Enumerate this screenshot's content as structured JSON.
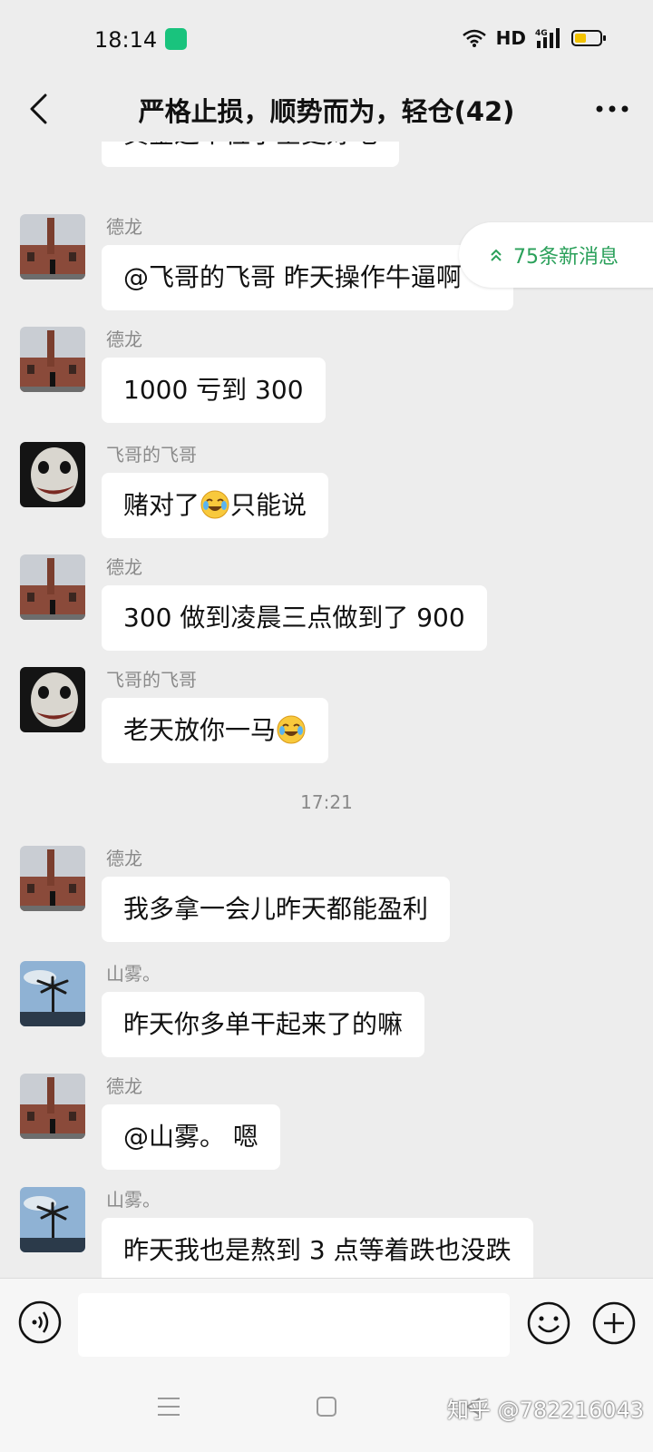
{
  "status_bar": {
    "time": "18:14",
    "network": "HD",
    "cell": "4G",
    "battery_level": 0.45
  },
  "header": {
    "title": "严格止损，顺势而为，轻仓(42)"
  },
  "new_messages": {
    "label": "75条新消息"
  },
  "messages": [
    {
      "sender": "",
      "text": "黄金这个位子空更好吧",
      "avatar": "red-avatar"
    },
    {
      "sender": "德龙",
      "text": "@飞哥的飞哥  昨天操作牛逼啊",
      "avatar": "chimney-avatar"
    },
    {
      "sender": "德龙",
      "text": "1000 亏到 300",
      "avatar": "chimney-avatar"
    },
    {
      "sender": "飞哥的飞哥",
      "text_before": "赌对了",
      "emoji": "crying-laughing-emoji",
      "text_after": "只能说",
      "avatar": "joker-avatar"
    },
    {
      "sender": "德龙",
      "text": "300 做到凌晨三点做到了 900",
      "avatar": "chimney-avatar"
    },
    {
      "sender": "飞哥的飞哥",
      "text_before": "老天放你一马",
      "emoji": "crying-laughing-emoji",
      "avatar": "joker-avatar"
    },
    {
      "time_separator": "17:21"
    },
    {
      "sender": "德龙",
      "text": "我多拿一会儿昨天都能盈利",
      "avatar": "chimney-avatar"
    },
    {
      "sender": "山雾。",
      "text": "昨天你多单干起来了的嘛",
      "avatar": "palm-avatar"
    },
    {
      "sender": "德龙",
      "text": "@山雾。 嗯",
      "avatar": "chimney-avatar"
    },
    {
      "sender": "山雾。",
      "text": "昨天我也是熬到 3 点等着跌也没跌",
      "avatar": "palm-avatar"
    }
  ],
  "input": {
    "value": "",
    "placeholder": ""
  },
  "watermark": "知乎 @782216043",
  "colors": {
    "background": "#ededed",
    "bubble": "#ffffff",
    "accent_green": "#2aa05a",
    "sender_gray": "#8a8a8a"
  }
}
